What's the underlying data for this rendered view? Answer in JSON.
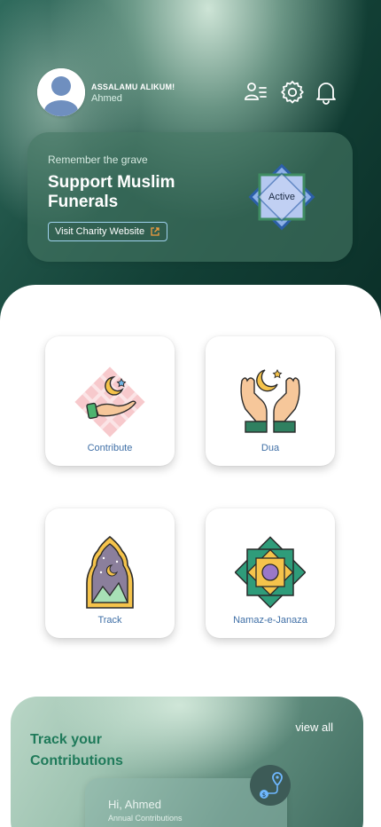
{
  "header": {
    "greeting": "ASSALAMU ALIKUM!",
    "username": "Ahmed",
    "icons": [
      "people-icon",
      "settings-icon",
      "bell-icon"
    ]
  },
  "banner": {
    "subtitle": "Remember the grave",
    "title": "Support Muslim Funerals",
    "button_label": "Visit Charity Website",
    "badge_label": "Active"
  },
  "grid": {
    "items": [
      {
        "label": "Contribute",
        "icon": "contribute-icon"
      },
      {
        "label": "Dua",
        "icon": "dua-hands-icon"
      },
      {
        "label": "Track",
        "icon": "track-mosque-window-icon"
      },
      {
        "label": "Namaz-e-Janaza",
        "icon": "islamic-star-icon"
      }
    ]
  },
  "track": {
    "title": "Track your Contributions",
    "view_all": "view all",
    "greeting": "Hi, Ahmed",
    "annual_label": "Annual Contributions"
  },
  "colors": {
    "header_dark": "#123f35",
    "accent_green": "#1f7a5a",
    "label_blue": "#3f6fa6"
  }
}
